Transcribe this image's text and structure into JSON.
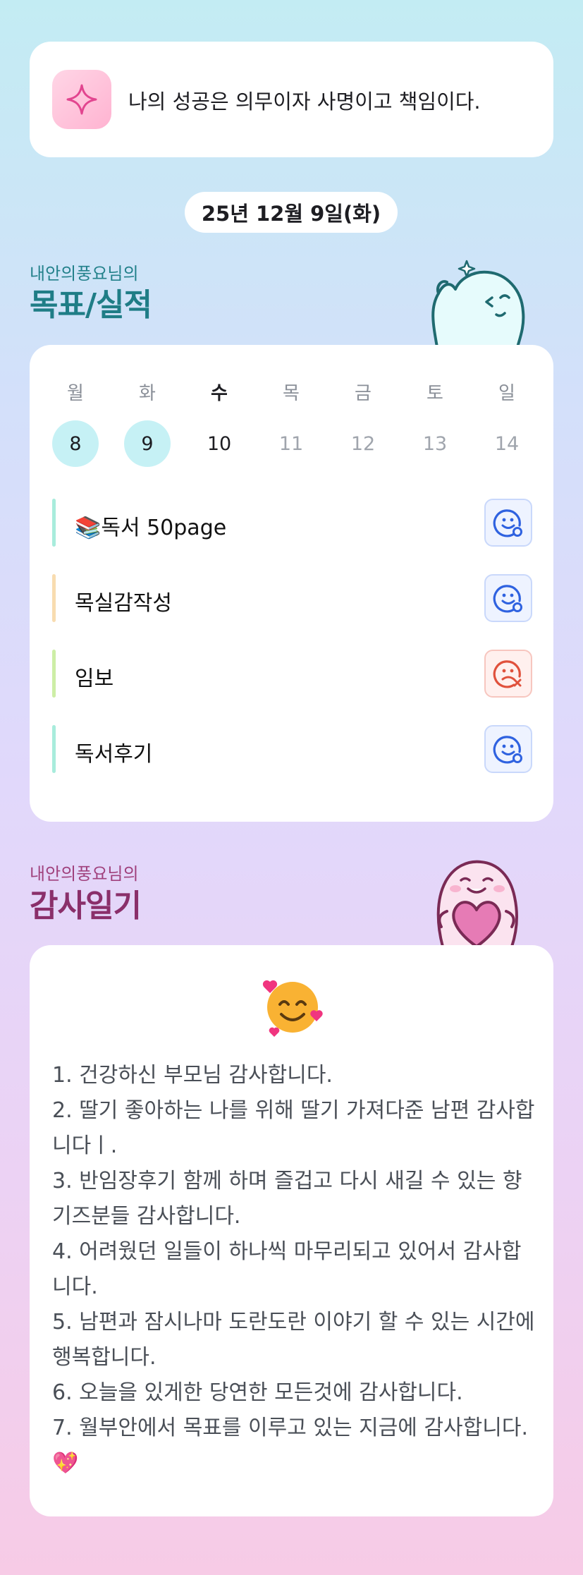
{
  "motto": {
    "text": "나의 성공은 의무이자 사명이고 책임이다.",
    "icon": "sparkle-icon"
  },
  "date": "25년 12월 9일(화)",
  "goals_section": {
    "subtitle": "내안의풍요님의",
    "title": "목표/실적"
  },
  "week": {
    "days": [
      {
        "name": "월",
        "num": "8",
        "state": "done"
      },
      {
        "name": "화",
        "num": "9",
        "state": "done"
      },
      {
        "name": "수",
        "num": "10",
        "state": "current"
      },
      {
        "name": "목",
        "num": "11",
        "state": "future"
      },
      {
        "name": "금",
        "num": "12",
        "state": "future"
      },
      {
        "name": "토",
        "num": "13",
        "state": "future"
      },
      {
        "name": "일",
        "num": "14",
        "state": "future"
      }
    ]
  },
  "goals": [
    {
      "label": "📚독서 50page",
      "status": "success",
      "accent": "#a8ecdc"
    },
    {
      "label": "목실감작성",
      "status": "success",
      "accent": "#f8dcb0"
    },
    {
      "label": "임보",
      "status": "fail",
      "accent": "#cdeea6"
    },
    {
      "label": "독서후기",
      "status": "success",
      "accent": "#a8ecdc"
    }
  ],
  "thanks_section": {
    "subtitle": "내안의풍요님의",
    "title": "감사일기"
  },
  "diary": {
    "emoji": "smiling-face-with-hearts-icon",
    "text": "1. 건강하신 부모님 감사합니다.\n2. 딸기 좋아하는 나를 위해 딸기 가져다준 남편 감사합니다ㅣ.\n3. 반임장후기 함께 하며 즐겁고 다시 새길 수 있는 향기즈분들 감사합니다.\n4. 어려웠던 일들이 하나씩 마무리되고 있어서 감사합니다.\n5. 남편과 잠시나마 도란도란 이야기 할 수 있는 시간에 행복합니다.\n6. 오늘을 있게한 당연한 모든것에 감사합니다.\n7. 월부안에서 목표를 이루고 있는 지금에 감사합니다. 💖"
  },
  "colors": {
    "teal": "#1f7d86",
    "plum": "#8a2f6a",
    "success": "#2f62e0",
    "fail": "#e0513c"
  }
}
